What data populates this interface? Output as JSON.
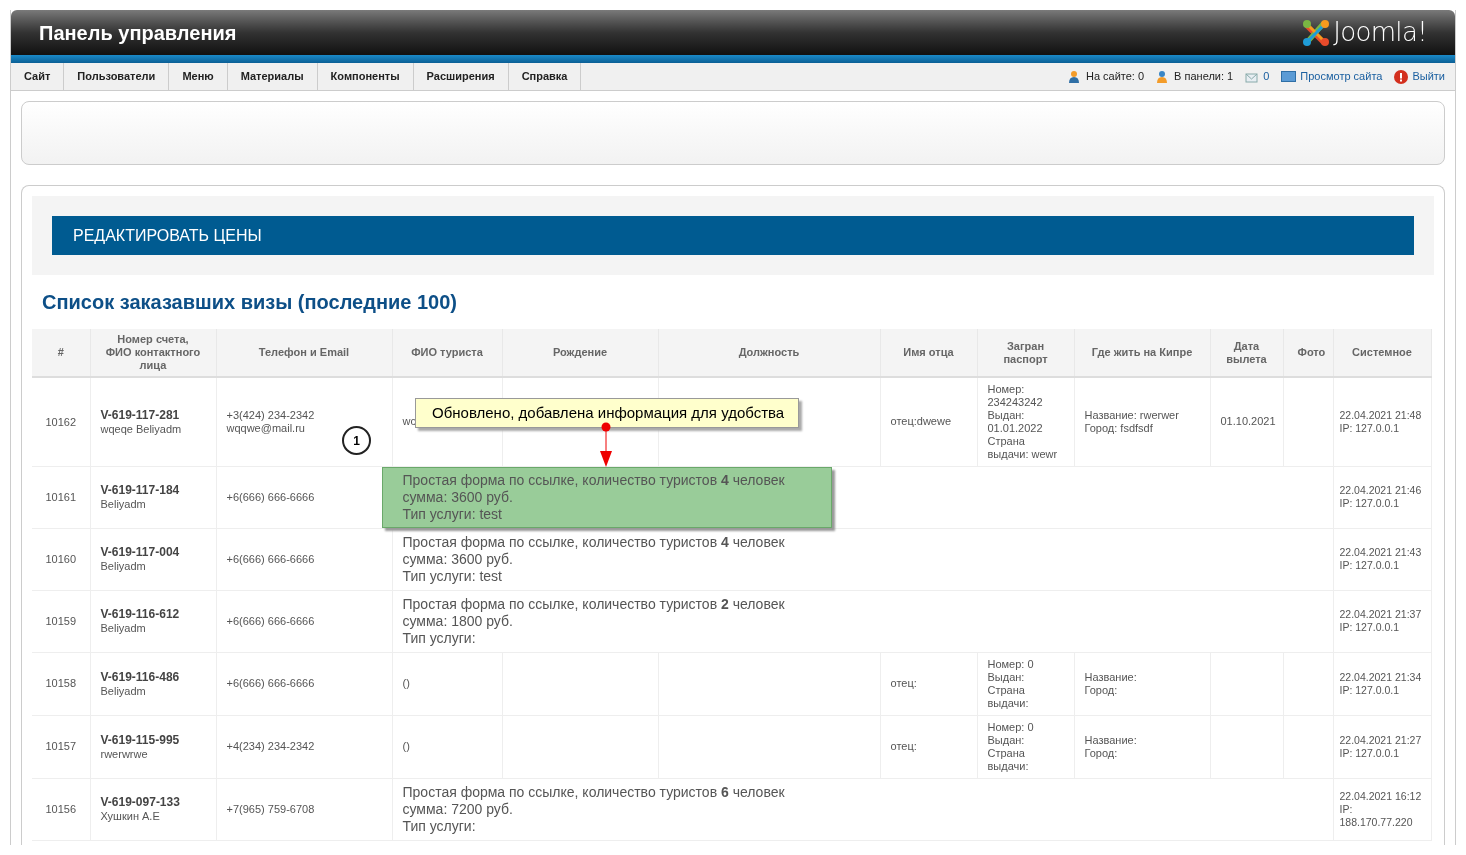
{
  "header": {
    "title": "Панель управления",
    "logo_text": "Joomla!"
  },
  "menu": [
    {
      "label": "Сайт"
    },
    {
      "label": "Пользователи"
    },
    {
      "label": "Меню"
    },
    {
      "label": "Материалы"
    },
    {
      "label": "Компоненты"
    },
    {
      "label": "Расширения"
    },
    {
      "label": "Справка"
    }
  ],
  "status": [
    {
      "kind": "online",
      "text": "На сайте: 0"
    },
    {
      "kind": "admin",
      "text": "В панели: 1"
    },
    {
      "kind": "messages",
      "text": "0"
    },
    {
      "kind": "preview",
      "text": "Просмотр сайта"
    },
    {
      "kind": "logout",
      "text": "Выйти"
    }
  ],
  "section_button": "РЕДАКТИРОВАТЬ ЦЕНЫ",
  "list_title": "Список заказавших визы (последние 100)",
  "table": {
    "columns": [
      "#",
      "Номер счета, ФИО контактного лица",
      "Телефон и Email",
      "ФИО туриста",
      "Рождение",
      "Должность",
      "Имя отца",
      "Загран паспорт",
      "Где жить на Кипре",
      "Дата вылета",
      "Фото",
      "Системное"
    ],
    "rows": [
      {
        "kind": "full",
        "num": "10162",
        "account": "V-619-117-281",
        "contact": "wqeqe Beliyadm",
        "phone": [
          "+3(424) 234-2342",
          "wqqwe@mail.ru"
        ],
        "tourist": [
          "wc"
        ],
        "father": "отец:dwewe",
        "passport": [
          "Номер: 234243242",
          "Выдан: 01.01.2022",
          "Страна выдачи: wewr"
        ],
        "residence": [
          "Название: rwerwer",
          "Город: fsdfsdf"
        ],
        "departure": "01.10.2021",
        "system": [
          "22.04.2021 21:48",
          "IP: 127.0.0.1"
        ]
      },
      {
        "kind": "simple",
        "num": "10161",
        "account": "V-619-117-184",
        "contact": "Beliyadm",
        "phone": [
          "+6(666) 666-6666"
        ],
        "form": [
          "Простая форма по ссылке, количество туристов **4** человек",
          "сумма: 3600 руб.",
          "Тип услуги: test"
        ],
        "highlighted": true,
        "system": [
          "22.04.2021 21:46",
          "IP: 127.0.0.1"
        ]
      },
      {
        "kind": "simple",
        "num": "10160",
        "account": "V-619-117-004",
        "contact": "Beliyadm",
        "phone": [
          "+6(666) 666-6666"
        ],
        "form": [
          "Простая форма по ссылке, количество туристов **4** человек",
          "сумма: 3600 руб.",
          "Тип услуги: test"
        ],
        "highlighted": false,
        "system": [
          "22.04.2021 21:43",
          "IP: 127.0.0.1"
        ]
      },
      {
        "kind": "simple",
        "num": "10159",
        "account": "V-619-116-612",
        "contact": "Beliyadm",
        "phone": [
          "+6(666) 666-6666"
        ],
        "form": [
          "Простая форма по ссылке, количество туристов **2** человек",
          "сумма: 1800 руб.",
          "Тип услуги:"
        ],
        "highlighted": false,
        "system": [
          "22.04.2021 21:37",
          "IP: 127.0.0.1"
        ]
      },
      {
        "kind": "full",
        "num": "10158",
        "account": "V-619-116-486",
        "contact": "Beliyadm",
        "phone": [
          "+6(666) 666-6666"
        ],
        "tourist": [
          "()"
        ],
        "father": "отец:",
        "passport": [
          "Номер: 0",
          "Выдан:",
          "Страна выдачи:"
        ],
        "residence": [
          "Название:",
          "Город:"
        ],
        "system": [
          "22.04.2021 21:34",
          "IP: 127.0.0.1"
        ]
      },
      {
        "kind": "full",
        "num": "10157",
        "account": "V-619-115-995",
        "contact": "rwerwrwe",
        "phone": [
          "+4(234) 234-2342"
        ],
        "tourist": [
          "()"
        ],
        "father": "отец:",
        "passport": [
          "Номер: 0",
          "Выдан:",
          "Страна выдачи:"
        ],
        "residence": [
          "Название:",
          "Город:"
        ],
        "system": [
          "22.04.2021 21:27",
          "IP: 127.0.0.1"
        ]
      },
      {
        "kind": "simple",
        "num": "10156",
        "account": "V-619-097-133",
        "contact": "Хушкин А.Е",
        "phone": [
          "+7(965) 759-6708"
        ],
        "form": [
          "Простая форма по ссылке, количество туристов **6** человек",
          "сумма: 7200 руб.",
          "Тип услуги:"
        ],
        "highlighted": false,
        "system": [
          "22.04.2021 16:12",
          "IP: 188.170.77.220"
        ]
      }
    ]
  },
  "annotations": [
    {
      "kind": "callout",
      "text": "Обновлено, добавлена информация для удобства"
    },
    {
      "kind": "marker",
      "text": "1"
    }
  ]
}
